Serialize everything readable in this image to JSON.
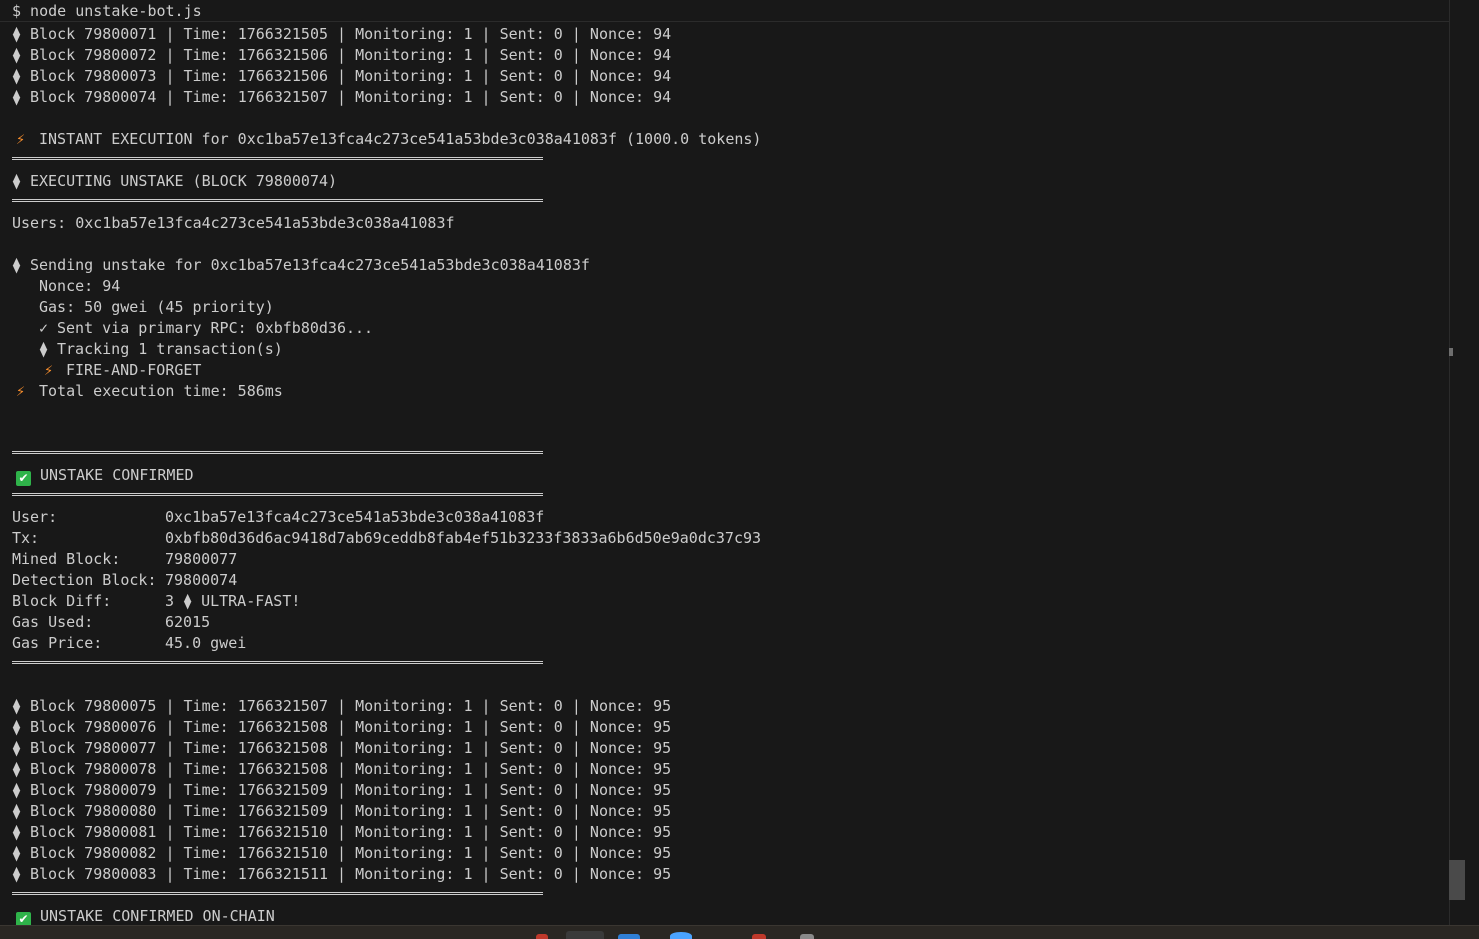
{
  "prompt": "$ node unstake-bot.js",
  "icons": {
    "diamond": "⧫",
    "bolt": "⚡",
    "check": "✓",
    "check_box": "✔"
  },
  "colors": {
    "background": "#181818",
    "text": "#cccccc",
    "bolt": "#f28b2c",
    "check_box": "#2fb34a"
  },
  "blocks_top": [
    "Block 79800071 | Time: 1766321505 | Monitoring: 1 | Sent: 0 | Nonce: 94",
    "Block 79800072 | Time: 1766321506 | Monitoring: 1 | Sent: 0 | Nonce: 94",
    "Block 79800073 | Time: 1766321506 | Monitoring: 1 | Sent: 0 | Nonce: 94",
    "Block 79800074 | Time: 1766321507 | Monitoring: 1 | Sent: 0 | Nonce: 94"
  ],
  "instant_execution": "INSTANT EXECUTION for 0xc1ba57e13fca4c273ce541a53bde3c038a41083f (1000.0 tokens)",
  "executing_unstake": "EXECUTING UNSTAKE (BLOCK 79800074)",
  "users_line": "Users: 0xc1ba57e13fca4c273ce541a53bde3c038a41083f",
  "sending_unstake": "Sending unstake for 0xc1ba57e13fca4c273ce541a53bde3c038a41083f",
  "nonce_line": "Nonce: 94",
  "gas_line": "Gas: 50 gwei (45 priority)",
  "sent_via": "Sent via primary RPC: 0xbfb80d36...",
  "tracking": "Tracking 1 transaction(s)",
  "fire_and_forget": "FIRE-AND-FORGET",
  "total_execution": "Total execution time: 586ms",
  "unstake_confirmed": "UNSTAKE CONFIRMED",
  "details": [
    {
      "label": "User:",
      "value": "0xc1ba57e13fca4c273ce541a53bde3c038a41083f"
    },
    {
      "label": "Tx:",
      "value": "0xbfb80d36d6ac9418d7ab69ceddb8fab4ef51b3233f3833a6b6d50e9a0dc37c93"
    },
    {
      "label": "Mined Block:",
      "value": "79800077"
    },
    {
      "label": "Detection Block:",
      "value": "79800074"
    },
    {
      "label": "Block Diff:",
      "value": "3",
      "suffix": "ULTRA-FAST!"
    },
    {
      "label": "Gas Used:",
      "value": "62015"
    },
    {
      "label": "Gas Price:",
      "value": "45.0 gwei"
    }
  ],
  "blocks_bottom": [
    "Block 79800075 | Time: 1766321507 | Monitoring: 1 | Sent: 0 | Nonce: 95",
    "Block 79800076 | Time: 1766321508 | Monitoring: 1 | Sent: 0 | Nonce: 95",
    "Block 79800077 | Time: 1766321508 | Monitoring: 1 | Sent: 0 | Nonce: 95",
    "Block 79800078 | Time: 1766321508 | Monitoring: 1 | Sent: 0 | Nonce: 95",
    "Block 79800079 | Time: 1766321509 | Monitoring: 1 | Sent: 0 | Nonce: 95",
    "Block 79800080 | Time: 1766321509 | Monitoring: 1 | Sent: 0 | Nonce: 95",
    "Block 79800081 | Time: 1766321510 | Monitoring: 1 | Sent: 0 | Nonce: 95",
    "Block 79800082 | Time: 1766321510 | Monitoring: 1 | Sent: 0 | Nonce: 95",
    "Block 79800083 | Time: 1766321511 | Monitoring: 1 | Sent: 0 | Nonce: 95"
  ],
  "unstake_confirmed_onchain": "UNSTAKE CONFIRMED ON-CHAIN"
}
